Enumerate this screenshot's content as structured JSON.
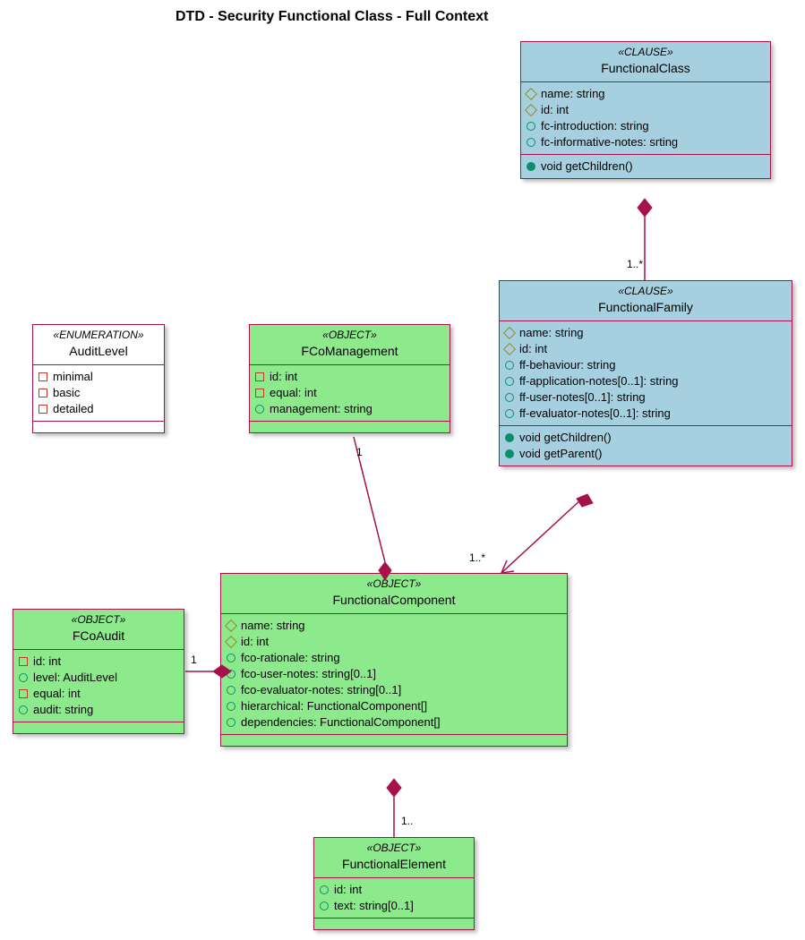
{
  "title": "DTD - Security Functional Class - Full Context",
  "functionalClass": {
    "stereo": "«CLAUSE»",
    "name": "FunctionalClass",
    "attrs": [
      "name: string",
      "id: int",
      "fc-introduction: string",
      "fc-informative-notes: srting"
    ],
    "ops": [
      "void getChildren()"
    ]
  },
  "functionalFamily": {
    "stereo": "«CLAUSE»",
    "name": "FunctionalFamily",
    "attrs": [
      "name: string",
      "id: int",
      "ff-behaviour: string",
      "ff-application-notes[0..1]: string",
      "ff-user-notes[0..1]: string",
      "ff-evaluator-notes[0..1]: string"
    ],
    "ops": [
      "void getChildren()",
      "void getParent()"
    ]
  },
  "auditLevel": {
    "stereo": "«ENUMERATION»",
    "name": "AuditLevel",
    "values": [
      "minimal",
      "basic",
      "detailed"
    ]
  },
  "fcoManagement": {
    "stereo": "«OBJECT»",
    "name": "FCoManagement",
    "attrs": [
      "id: int",
      "equal: int",
      "management: string"
    ]
  },
  "functionalComponent": {
    "stereo": "«OBJECT»",
    "name": "FunctionalComponent",
    "attrs": [
      "name: string",
      "id: int",
      "fco-rationale: string",
      "fco-user-notes: string[0..1]",
      "fco-evaluator-notes: string[0..1]",
      "hierarchical: FunctionalComponent[]",
      "dependencies: FunctionalComponent[]"
    ]
  },
  "fcoAudit": {
    "stereo": "«OBJECT»",
    "name": "FCoAudit",
    "attrs": [
      "id: int",
      "level: AuditLevel",
      "equal: int",
      "audit: string"
    ]
  },
  "functionalElement": {
    "stereo": "«OBJECT»",
    "name": "FunctionalElement",
    "attrs": [
      "id: int",
      "text: string[0..1]"
    ]
  },
  "mult": {
    "classToFamily": "1..*",
    "familyToComponent": "1..*",
    "componentToManagement": "1",
    "componentToAudit": "1",
    "componentToElement": "1.."
  }
}
